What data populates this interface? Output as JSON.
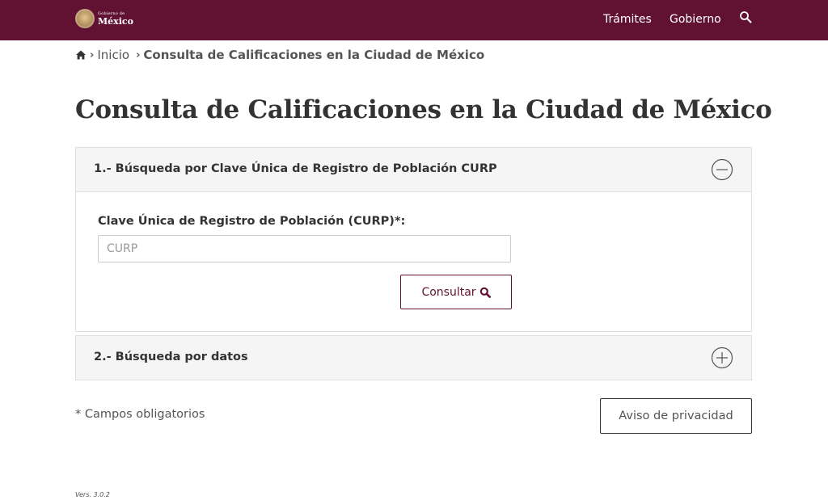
{
  "header": {
    "logo": {
      "line1": "Gobierno de",
      "line2": "México"
    },
    "nav": {
      "tramites": "Trámites",
      "gobierno": "Gobierno"
    },
    "icons": {
      "search": "search-icon"
    }
  },
  "breadcrumb": {
    "home_icon": "home-icon",
    "separator": "›",
    "inicio": "Inicio",
    "current": "Consulta de Calificaciones en la Ciudad de México"
  },
  "page": {
    "title": "Consulta de Calificaciones en la Ciudad de México"
  },
  "panels": [
    {
      "title": "1.- Búsqueda por Clave Única de Registro de Población CURP",
      "state": "expanded",
      "toggle_icon": "minus-circle-icon",
      "field_label": "Clave Única de Registro de Población (CURP)*:",
      "input_value": "",
      "input_placeholder": "CURP",
      "button_label": "Consultar",
      "button_icon": "search-icon"
    },
    {
      "title": "2.- Búsqueda por datos",
      "state": "collapsed",
      "toggle_icon": "plus-circle-icon"
    }
  ],
  "footer": {
    "required_note": "* Campos obligatorios",
    "privacy_button": "Aviso de privacidad",
    "version": "Vers. 3.0.2"
  },
  "colors": {
    "brand": "#611232",
    "text": "#333333",
    "muted": "#545454",
    "panel_header": "#f5f5f5",
    "border": "#e0e0e0"
  }
}
